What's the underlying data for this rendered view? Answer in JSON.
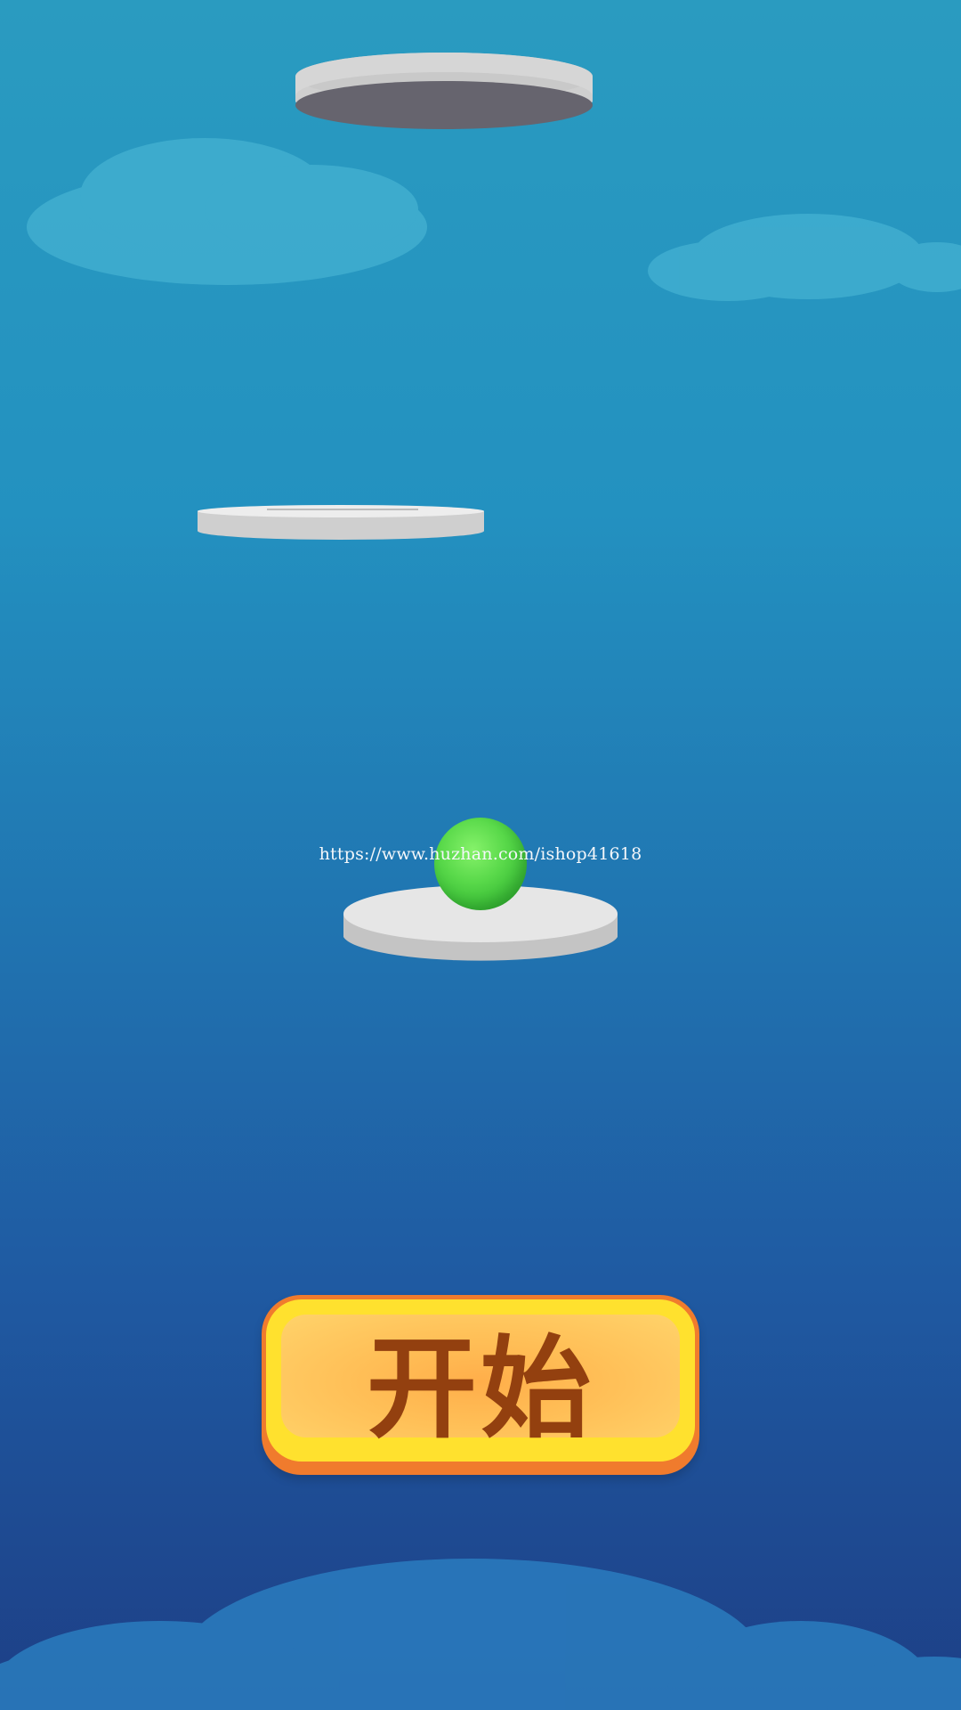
{
  "scene": {
    "background_top": "#2a9bc0",
    "background_bottom": "#1d3f86",
    "cloud_color": "#4fbcd8",
    "platform_color": "#e6e6e6",
    "ball_color": "#4cd13c"
  },
  "watermark": {
    "text": "https://www.huzhan.com/ishop41618"
  },
  "start_button": {
    "label": "开始",
    "face_color": "#ffc35e",
    "rim_color": "#ffe12e",
    "border_color": "#f07b2d",
    "text_color": "#93400f"
  },
  "icons": {
    "ball": "green-ball",
    "platforms": "disc-platform",
    "clouds": "cloud"
  }
}
